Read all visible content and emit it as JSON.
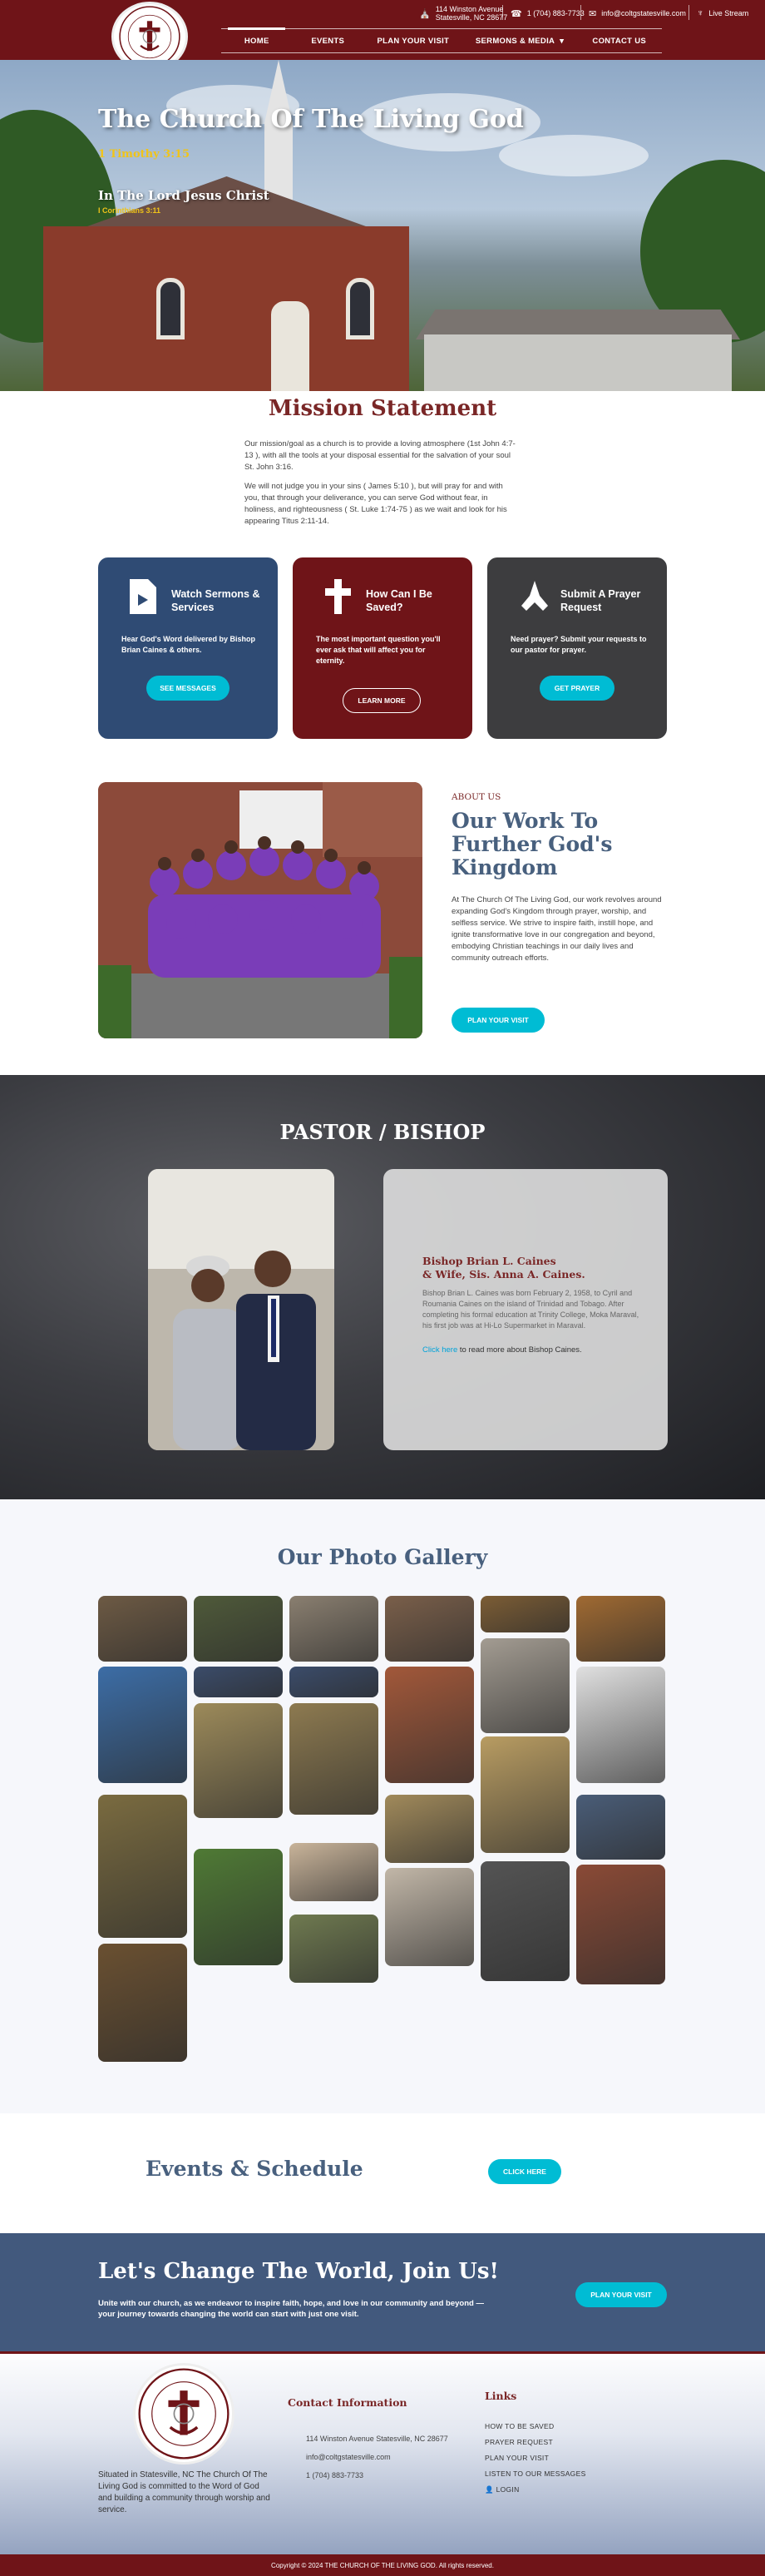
{
  "header": {
    "address_line1": "114 Winston Avenue",
    "address_line2": "Statesville, NC 28677",
    "phone": "1 (704) 883-7733",
    "email": "info@coltgstatesville.com",
    "live_stream": "Live Stream",
    "nav": [
      {
        "label": "HOME"
      },
      {
        "label": "EVENTS"
      },
      {
        "label": "PLAN YOUR VISIT"
      },
      {
        "label": "SERMONS & MEDIA"
      },
      {
        "label": "CONTACT US"
      }
    ],
    "dropdown_icon": "▾",
    "logo_text": "CHURCH OF THE LIVING GOD",
    "logo_text2": "IN THE LORD JESUS CHRIST"
  },
  "hero": {
    "title": "The Church Of The Living God",
    "verse": "1 Timothy 3:15",
    "subtitle": "In The Lord Jesus Christ",
    "subverse": "I Corinthians 3:11"
  },
  "mission": {
    "title": "Mission Statement",
    "p1": "Our mission/goal as a church is to provide a loving atmosphere (1st John 4:7-13 ), with all the tools at your disposal essential for the salvation of your soul St. John 3:16.",
    "p2": "We will not judge you in your sins ( James 5:10 ), but will pray for and with you, that through your deliverance, you can serve God without fear, in holiness, and righteousness ( St. Luke 1:74-75 ) as we wait and look for his appearing Titus 2:11-14."
  },
  "cards": [
    {
      "icon": "video-file-icon",
      "title": "Watch Sermons & Services",
      "text": "Hear God's Word delivered by Bishop Brian Caines & others.",
      "button": "SEE MESSAGES"
    },
    {
      "icon": "cross-icon",
      "title": "How Can I Be Saved?",
      "text": "The most important question you'll ever ask that will affect you for eternity.",
      "button": "LEARN MORE"
    },
    {
      "icon": "praying-hands-icon",
      "title": "Submit A Prayer Request",
      "text": "Need prayer? Submit your requests to our pastor for prayer.",
      "button": "GET PRAYER"
    }
  ],
  "about": {
    "label": "ABOUT US",
    "title": "Our Work To Further God's Kingdom",
    "text": "At The Church Of The Living God, our work revolves around expanding God's Kingdom through prayer, worship, and selfless service. We strive to inspire faith, instill hope, and ignite transformative love in our congregation and beyond, embodying Christian teachings in our daily lives and community outreach efforts.",
    "button": "PLAN YOUR VISIT"
  },
  "pastor": {
    "title": "PASTOR / BISHOP",
    "name_line1": "Bishop Brian L. Caines",
    "name_line2": "& Wife, Sis. Anna A. Caines.",
    "bio": "Bishop Brian L. Caines was born February 2, 1958, to Cyril and Roumania Caines on the island of Trinidad and Tobago. After completing his formal education at Trinity College, Moka Maraval, his first job was at Hi-Lo Supermarket in Maraval.",
    "link": "Click here",
    "link_suffix": " to read more about Bishop Caines."
  },
  "gallery": {
    "title": "Our Photo Gallery"
  },
  "events": {
    "title": "Events & Schedule",
    "button": "CLICK HERE"
  },
  "cta": {
    "title": "Let's Change The World, Join Us!",
    "text": "Unite with our church, as we endeavor to inspire faith, hope, and love in our community and beyond — your journey towards changing the world can start with just one visit.",
    "button": "PLAN YOUR VISIT"
  },
  "footer": {
    "about": "Situated in Statesville, NC The Church Of The Living God is committed to the Word of God and building a community through worship and service.",
    "contact_heading": "Contact Information",
    "address": "114 Winston Avenue Statesville, NC 28677",
    "email": "info@coltgstatesville.com",
    "phone": "1 (704) 883-7733",
    "links_heading": "Links",
    "links": [
      "HOW TO BE SAVED",
      "PRAYER REQUEST",
      "PLAN YOUR VISIT",
      "LISTEN TO OUR MESSAGES",
      "LOGIN"
    ],
    "copyright": "Copyright © 2024 THE CHURCH OF THE LIVING GOD. All rights reserved."
  },
  "colors": {
    "maroon": "#6f1418",
    "navy": "#2f4b74",
    "accent_cyan": "#00bcd4",
    "gold": "#f0c419"
  }
}
